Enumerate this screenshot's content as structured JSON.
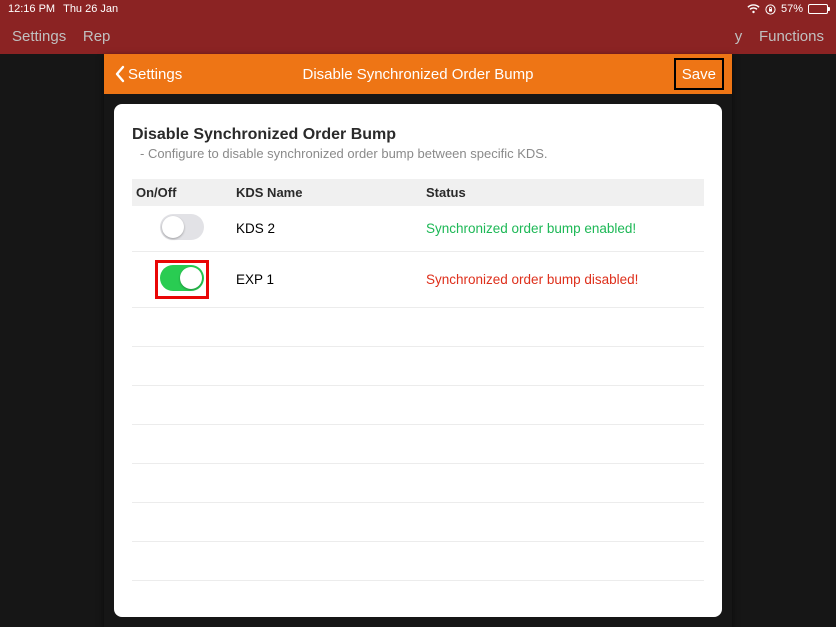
{
  "statusbar": {
    "time": "12:16 PM",
    "date": "Thu 26 Jan",
    "battery_pct": "57%"
  },
  "toolbar": {
    "left_a": "Settings",
    "left_b": "Rep",
    "right_a": "y",
    "right_b": "Functions"
  },
  "modal": {
    "back_label": "Settings",
    "title": "Disable Synchronized Order Bump",
    "save_label": "Save"
  },
  "section": {
    "title": "Disable Synchronized Order Bump",
    "subtitle": "- Configure to disable synchronized order bump between specific KDS."
  },
  "columns": {
    "onoff": "On/Off",
    "kdsname": "KDS Name",
    "status": "Status"
  },
  "rows": [
    {
      "toggle_on": false,
      "highlight": false,
      "name": "KDS 2",
      "status": "Synchronized order bump enabled!",
      "status_class": "status-enabled"
    },
    {
      "toggle_on": true,
      "highlight": true,
      "name": "EXP 1",
      "status": "Synchronized order bump disabled!",
      "status_class": "status-disabled"
    }
  ],
  "colors": {
    "accent": "#ee7515",
    "status_bg": "#8b2323",
    "enabled": "#1db856",
    "disabled": "#de2f1b",
    "toggle_on": "#29cc52"
  }
}
